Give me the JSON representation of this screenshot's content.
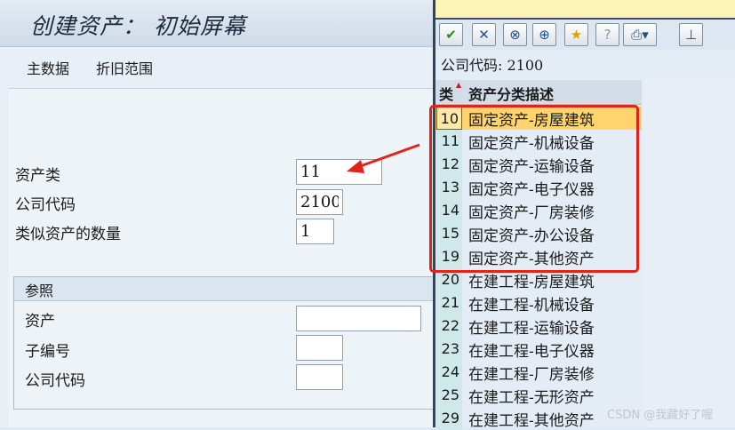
{
  "screen": {
    "title": "创建资产： 初始屏幕",
    "toolbar": {
      "master_data": "主数据",
      "depreciation_areas": "折旧范围"
    },
    "form": {
      "asset_class_label": "资产类",
      "asset_class_value": "11",
      "company_code_label": "公司代码",
      "company_code_value": "2100",
      "similar_count_label": "类似资产的数量",
      "similar_count_value": "1"
    },
    "reference": {
      "title": "参照",
      "asset_label": "资产",
      "asset_value": "",
      "subnumber_label": "子编号",
      "subnumber_value": "",
      "company_code_label": "公司代码",
      "company_code_value": ""
    }
  },
  "popup": {
    "company_line": "公司代码: 2100",
    "header": {
      "key": "类",
      "description": "资产分类描述"
    },
    "toolbar_icons": [
      "check-icon",
      "close-icon",
      "binoculars-icon",
      "binoculars-next-icon",
      "favorite-add-icon",
      "help-icon",
      "print-icon",
      "pin-icon"
    ],
    "rows": [
      {
        "key": "10",
        "description": "固定资产-房屋建筑"
      },
      {
        "key": "11",
        "description": "固定资产-机械设备"
      },
      {
        "key": "12",
        "description": "固定资产-运输设备"
      },
      {
        "key": "13",
        "description": "固定资产-电子仪器"
      },
      {
        "key": "14",
        "description": "固定资产-厂房装修"
      },
      {
        "key": "15",
        "description": "固定资产-办公设备"
      },
      {
        "key": "19",
        "description": "固定资产-其他资产"
      },
      {
        "key": "20",
        "description": "在建工程-房屋建筑"
      },
      {
        "key": "21",
        "description": "在建工程-机械设备"
      },
      {
        "key": "22",
        "description": "在建工程-运输设备"
      },
      {
        "key": "23",
        "description": "在建工程-电子仪器"
      },
      {
        "key": "24",
        "description": "在建工程-厂房装修"
      },
      {
        "key": "25",
        "description": "在建工程-无形资产"
      },
      {
        "key": "29",
        "description": "在建工程-其他资产"
      }
    ],
    "selected_row": "10"
  },
  "annotation": {
    "highlight_color": "#e2231a"
  },
  "watermark": "CSDN @我藏好了喔"
}
